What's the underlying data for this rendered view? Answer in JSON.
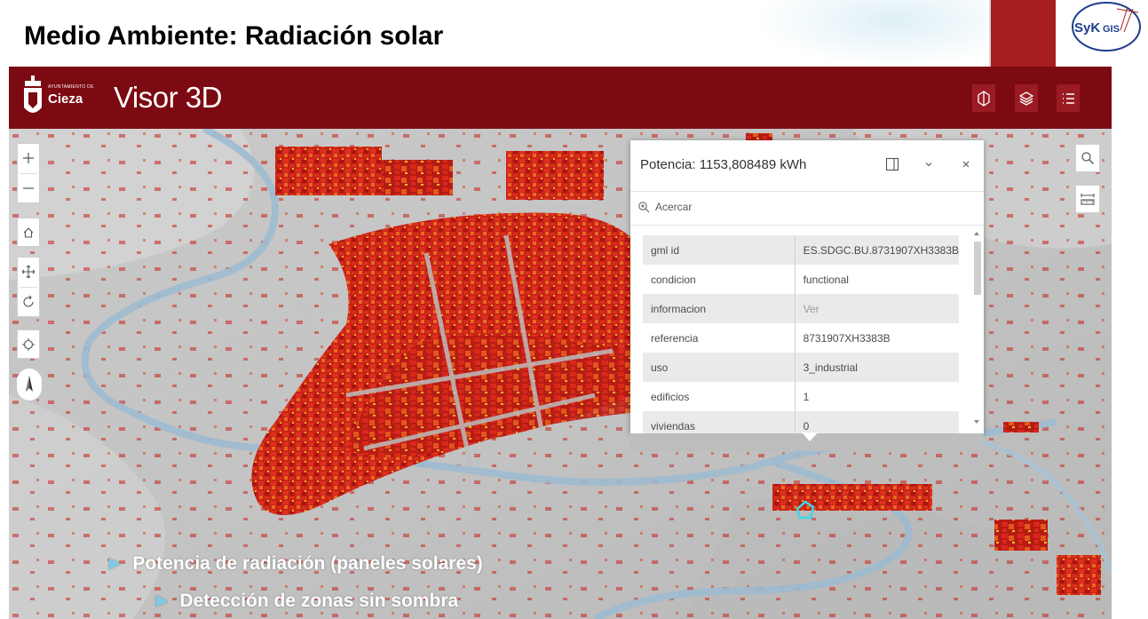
{
  "slide": {
    "title": "Medio Ambiente: Radiación solar",
    "logo_text": "SyKGIS"
  },
  "app": {
    "municipality_name": "Cieza",
    "municipality_caption": "AYUNTAMIENTO DE",
    "title": "Visor 3D",
    "header_color": "#7c0a12",
    "header_buttons": [
      "basemap-icon",
      "layers-icon",
      "legend-list-icon"
    ]
  },
  "map_controls": {
    "left": [
      "zoom-in-icon",
      "zoom-out-icon",
      "home-icon",
      "pan-icon",
      "rotate-icon",
      "locate-icon",
      "compass-icon"
    ],
    "right": [
      "search-icon",
      "measure-icon"
    ]
  },
  "popup": {
    "title": "Potencia: 1153,808489 kWh",
    "zoom_label": "Acercar",
    "attributes": [
      {
        "key": "gml id",
        "value": "ES.SDGC.BU.8731907XH3383B"
      },
      {
        "key": "condicion",
        "value": "functional"
      },
      {
        "key": "informacion",
        "value": "Ver"
      },
      {
        "key": "referencia",
        "value": "8731907XH3383B"
      },
      {
        "key": "uso",
        "value": "3_industrial"
      },
      {
        "key": "edificios",
        "value": "1"
      },
      {
        "key": "viviendas",
        "value": "0"
      }
    ]
  },
  "bullets": {
    "level1": "Potencia de radiación (paneles solares)",
    "level2": "Detección de zonas sin sombra"
  },
  "colors": {
    "slide_accent": "#a51d1e",
    "bullet_marker": "#7ec9e6",
    "building_high": "#d8261c",
    "building_mid": "#e5701c",
    "building_low": "#e8c21c",
    "river": "#9dbad0"
  }
}
